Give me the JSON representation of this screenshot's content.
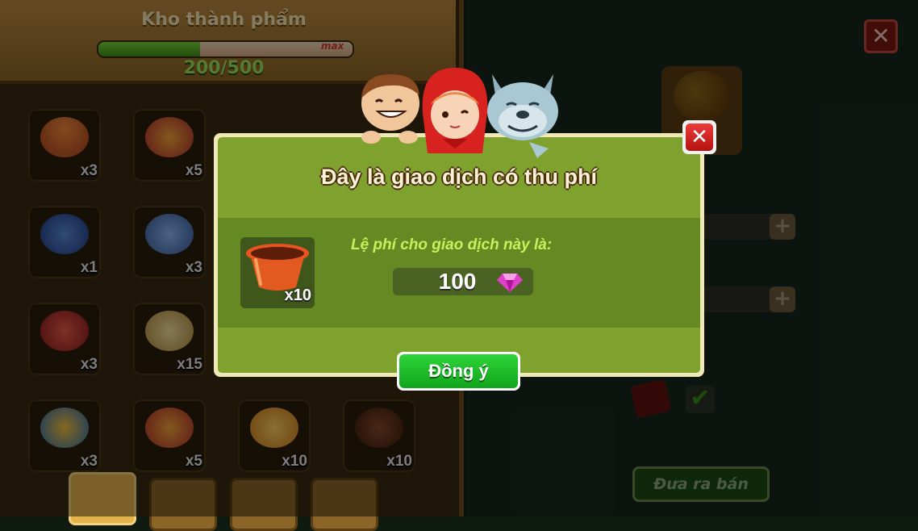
{
  "background": {
    "storage": {
      "title": "Kho thành phẩm",
      "progress_text": "200/500",
      "progress_max_label": "max",
      "progress_fraction": 0.4
    },
    "inventory": [
      {
        "icon": "flower-pot-icon",
        "qty": "x3"
      },
      {
        "icon": "potion-bottle-icon",
        "qty": "x5"
      },
      {
        "icon": "blue-teapot-icon",
        "qty": "x1"
      },
      {
        "icon": "blue-vase-icon",
        "qty": "x3"
      },
      {
        "icon": "red-bottle-icon",
        "qty": "x3"
      },
      {
        "icon": "bandage-roll-icon",
        "qty": "x15"
      },
      {
        "icon": "honey-jar-icon",
        "qty": "x3"
      },
      {
        "icon": "potion-bottle-icon",
        "qty": "x5"
      },
      {
        "icon": "orange-candy-icon",
        "qty": "x10"
      },
      {
        "icon": "brown-drum-icon",
        "qty": "x10"
      }
    ],
    "right_side": {
      "close_glyph": "✕",
      "plus_glyph": "+",
      "checkmark_glyph": "✔",
      "sell_button_label": "Đưa ra bán"
    }
  },
  "dialog": {
    "title": "Đây là giao dịch có thu phí",
    "fee_label": "Lệ phí cho giao dịch này là:",
    "item": {
      "icon": "flower-pot-icon",
      "qty": "x10"
    },
    "price": "100",
    "currency_icon": "pink-gem-icon",
    "close_glyph": "✕",
    "confirm_label": "Đồng ý"
  },
  "colors": {
    "dialog_green": "#7ea22d",
    "dialog_band": "#658a24",
    "fee_label": "#c5f25b",
    "confirm_green": "#10a51c",
    "close_red": "#d8221f",
    "gem_pink": "#e040c8"
  }
}
